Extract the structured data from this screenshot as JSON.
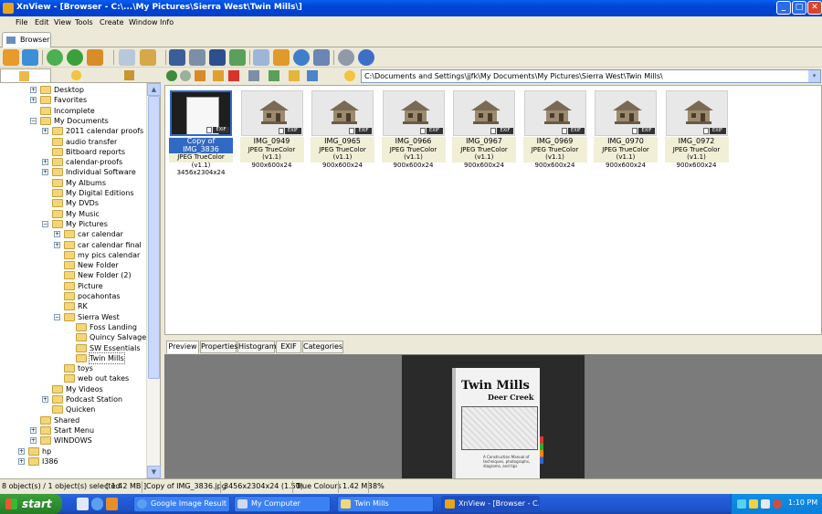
{
  "window": {
    "title": "XnView - [Browser - C:\\...\\My Pictures\\Sierra West\\Twin Mills\\]",
    "min": "_",
    "max": "□",
    "close": "✕"
  },
  "menu": [
    "File",
    "Edit",
    "View",
    "Tools",
    "Create",
    "Window",
    "Info"
  ],
  "tab": {
    "label": "Browser"
  },
  "address": {
    "path": "C:\\Documents and Settings\\jjfk\\My Documents\\My Pictures\\Sierra West\\Twin Mills\\",
    "dropdown": "▾"
  },
  "tree": [
    {
      "label": "Desktop",
      "indent": 0,
      "exp": "+"
    },
    {
      "label": "Favorites",
      "indent": 0,
      "exp": "+"
    },
    {
      "label": "Incomplete",
      "indent": 0,
      "exp": ""
    },
    {
      "label": "My Documents",
      "indent": 0,
      "exp": "−"
    },
    {
      "label": "2011 calendar proofs",
      "indent": 1,
      "exp": "+"
    },
    {
      "label": "audio transfer",
      "indent": 1,
      "exp": ""
    },
    {
      "label": "Bitboard reports",
      "indent": 1,
      "exp": ""
    },
    {
      "label": "calendar-proofs",
      "indent": 1,
      "exp": "+"
    },
    {
      "label": "Individual Software",
      "indent": 1,
      "exp": "+"
    },
    {
      "label": "My Albums",
      "indent": 1,
      "exp": ""
    },
    {
      "label": "My Digital Editions",
      "indent": 1,
      "exp": ""
    },
    {
      "label": "My DVDs",
      "indent": 1,
      "exp": ""
    },
    {
      "label": "My Music",
      "indent": 1,
      "exp": ""
    },
    {
      "label": "My Pictures",
      "indent": 1,
      "exp": "−"
    },
    {
      "label": "car calendar",
      "indent": 2,
      "exp": "+"
    },
    {
      "label": "car calendar final",
      "indent": 2,
      "exp": "+"
    },
    {
      "label": "my pics calendar",
      "indent": 2,
      "exp": ""
    },
    {
      "label": "New Folder",
      "indent": 2,
      "exp": ""
    },
    {
      "label": "New Folder (2)",
      "indent": 2,
      "exp": ""
    },
    {
      "label": "Picture",
      "indent": 2,
      "exp": ""
    },
    {
      "label": "pocahontas",
      "indent": 2,
      "exp": ""
    },
    {
      "label": "RK",
      "indent": 2,
      "exp": ""
    },
    {
      "label": "Sierra West",
      "indent": 2,
      "exp": "−"
    },
    {
      "label": "Foss Landing",
      "indent": 3,
      "exp": ""
    },
    {
      "label": "Quincy Salvage",
      "indent": 3,
      "exp": ""
    },
    {
      "label": "SW Essentials",
      "indent": 3,
      "exp": ""
    },
    {
      "label": "Twin Mills",
      "indent": 3,
      "exp": "",
      "selected": true
    },
    {
      "label": "toys",
      "indent": 2,
      "exp": ""
    },
    {
      "label": "web out takes",
      "indent": 2,
      "exp": ""
    },
    {
      "label": "My Videos",
      "indent": 1,
      "exp": ""
    },
    {
      "label": "Podcast Station",
      "indent": 1,
      "exp": "+"
    },
    {
      "label": "Quicken",
      "indent": 1,
      "exp": ""
    },
    {
      "label": "Shared",
      "indent": 0,
      "exp": ""
    },
    {
      "label": "Start Menu",
      "indent": 0,
      "exp": "+"
    },
    {
      "label": "WINDOWS",
      "indent": 0,
      "exp": "+"
    },
    {
      "label": "hp",
      "indent": -1,
      "exp": "+"
    },
    {
      "label": "I386",
      "indent": -1,
      "exp": "+"
    }
  ],
  "thumbnails": [
    {
      "name": "Copy of IMG_3836",
      "type": "JPEG TrueColor (v1.1)",
      "dims": "3456x2304x24",
      "selected": true,
      "kind": "book"
    },
    {
      "name": "IMG_0949",
      "type": "JPEG TrueColor (v1.1)",
      "dims": "900x600x24",
      "kind": "house"
    },
    {
      "name": "IMG_0965",
      "type": "JPEG TrueColor (v1.1)",
      "dims": "900x600x24",
      "kind": "house"
    },
    {
      "name": "IMG_0966",
      "type": "JPEG TrueColor (v1.1)",
      "dims": "900x600x24",
      "kind": "house"
    },
    {
      "name": "IMG_0967",
      "type": "JPEG TrueColor (v1.1)",
      "dims": "900x600x24",
      "kind": "house"
    },
    {
      "name": "IMG_0969",
      "type": "JPEG TrueColor (v1.1)",
      "dims": "900x600x24",
      "kind": "house"
    },
    {
      "name": "IMG_0970",
      "type": "JPEG TrueColor (v1.1)",
      "dims": "900x600x24",
      "kind": "house"
    },
    {
      "name": "IMG_0972",
      "type": "JPEG TrueColor (v1.1)",
      "dims": "900x600x24",
      "kind": "house"
    }
  ],
  "exif_badge": "EXIF",
  "preview_tabs": [
    "Preview",
    "Properties",
    "Histogram",
    "EXIF",
    "Categories"
  ],
  "preview": {
    "title1": "Twin Mills",
    "title2": "Deer Creek",
    "subtitle": "A Construction Manual of techniques, photographs, diagrams, and tips"
  },
  "status": {
    "count": "8 object(s) / 1 object(s) selected",
    "size": "[ 1.42 MB ]",
    "file": "Copy of IMG_3836.jpg",
    "dims": "3456x2304x24 (1.50)",
    "colors": "True Colours",
    "filesize": "1.42 MB",
    "zoom": "8%"
  },
  "taskbar": {
    "start": "start",
    "tasks": [
      {
        "label": "Google Image Result ...",
        "active": false
      },
      {
        "label": "My Computer",
        "active": false
      },
      {
        "label": "Twin Mills",
        "active": false
      },
      {
        "label": "XnView - [Browser - C...",
        "active": true
      }
    ],
    "clock": "1:10 PM"
  },
  "colors": {
    "accent": "#316ac5",
    "title": "#0a5ef0",
    "start": "#3c9f3c"
  }
}
